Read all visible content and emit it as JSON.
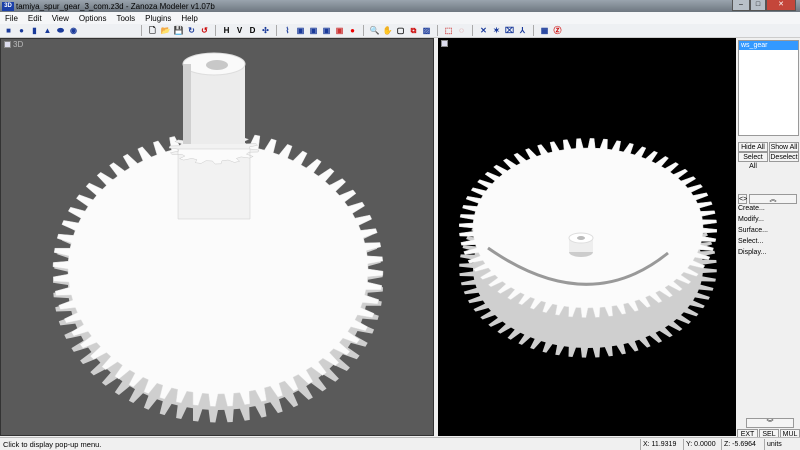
{
  "window": {
    "title": "tamiya_spur_gear_3_com.z3d - Zanoza Modeler v1.07b",
    "logo": "3D",
    "minimize": "–",
    "maximize": "□",
    "close": "✕"
  },
  "menu": [
    "File",
    "Edit",
    "View",
    "Options",
    "Tools",
    "Plugins",
    "Help"
  ],
  "toolbar": {
    "view_buttons": [
      "H",
      "V",
      "D"
    ]
  },
  "viewport_left": {
    "label": "3D",
    "background": "#5a5a5a"
  },
  "viewport_right": {
    "background": "#000000"
  },
  "panel": {
    "objects": [
      "ws_gear"
    ],
    "hide_all": "Hide All",
    "show_all": "Show All",
    "select_all": "Select All",
    "deselect": "Deselect",
    "toggle": "<>",
    "commands": [
      "Create...",
      "Modify...",
      "Surface...",
      "Select...",
      "Display..."
    ],
    "modes": [
      "EXT",
      "SEL",
      "MUL"
    ]
  },
  "status": {
    "message": "Click to display pop-up menu.",
    "x": "X: 11.9319",
    "y": "Y: 0.0000",
    "z": "Z: -5.6964",
    "units": "units"
  }
}
